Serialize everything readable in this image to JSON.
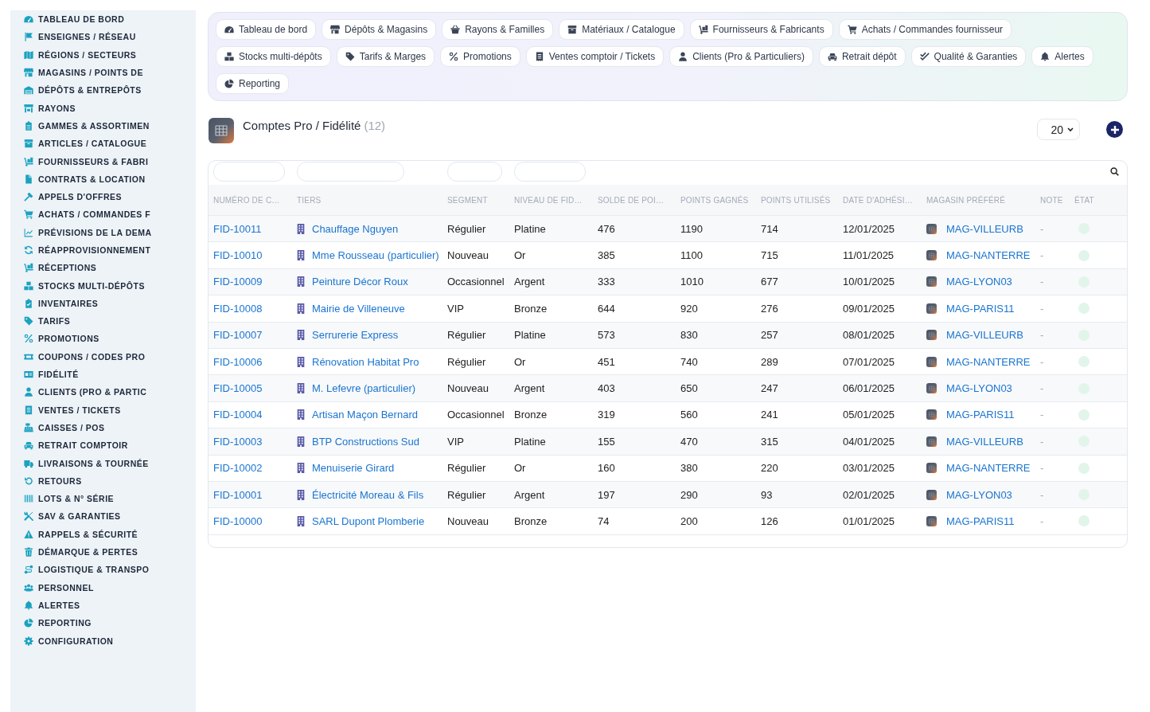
{
  "sidebar": {
    "items": [
      "TABLEAU DE BORD",
      "ENSEIGNES / RÉSEAU",
      "RÉGIONS / SECTEURS",
      "MAGASINS / POINTS DE",
      "DÉPÔTS & ENTREPÔTS",
      "RAYONS",
      "GAMMES & ASSORTIMEN",
      "ARTICLES / CATALOGUE",
      "FOURNISSEURS & FABRI",
      "CONTRATS & LOCATION",
      "APPELS D'OFFRES",
      "ACHATS / COMMANDES F",
      "PRÉVISIONS DE LA DEMA",
      "RÉAPPROVISIONNEMENT",
      "RÉCEPTIONS",
      "STOCKS MULTI-DÉPÔTS",
      "INVENTAIRES",
      "TARIFS",
      "PROMOTIONS",
      "COUPONS / CODES PRO",
      "FIDÉLITÉ",
      "CLIENTS (PRO & PARTIC",
      "VENTES / TICKETS",
      "CAISSES / POS",
      "RETRAIT COMPTOIR",
      "LIVRAISONS & TOURNÉE",
      "RETOURS",
      "LOTS & N° SÉRIE",
      "SAV & GARANTIES",
      "RAPPELS & SÉCURITÉ",
      "DÉMARQUE & PERTES",
      "LOGISTIQUE & TRANSPO",
      "PERSONNEL",
      "ALERTES",
      "REPORTING",
      "CONFIGURATION"
    ]
  },
  "nav": {
    "items": [
      "Tableau de bord",
      "Dépôts & Magasins",
      "Rayons & Familles",
      "Matériaux / Catalogue",
      "Fournisseurs & Fabricants",
      "Achats / Commandes fournisseur",
      "Stocks multi-dépôts",
      "Tarifs & Marges",
      "Promotions",
      "Ventes comptoir / Tickets",
      "Clients (Pro & Particuliers)",
      "Retrait dépôt",
      "Qualité & Garanties",
      "Alertes",
      "Reporting"
    ]
  },
  "header": {
    "title": "Comptes Pro / Fidélité",
    "count": "(12)",
    "page_size": "20"
  },
  "table": {
    "columns": [
      {
        "label": "NUMÉRO DE C…",
        "kind": "link",
        "filter": true
      },
      {
        "label": "TIERS",
        "kind": "entity",
        "filter": true
      },
      {
        "label": "SEGMENT",
        "kind": "text",
        "filter": true
      },
      {
        "label": "NIVEAU DE FID…",
        "kind": "text",
        "filter": true
      },
      {
        "label": "SOLDE DE POI…",
        "kind": "text",
        "filter": false
      },
      {
        "label": "POINTS GAGNÉS",
        "kind": "text",
        "filter": false
      },
      {
        "label": "POINTS UTILISÉS",
        "kind": "text",
        "filter": false
      },
      {
        "label": "DATE D'ADHÉSI…",
        "kind": "text",
        "filter": false
      },
      {
        "label": "MAGASIN PRÉFÉRÉ",
        "kind": "store",
        "filter": false
      },
      {
        "label": "NOTE",
        "kind": "muted",
        "filter": false
      },
      {
        "label": "ÉTAT",
        "kind": "status",
        "filter": false
      }
    ],
    "rows": [
      {
        "cells": [
          "FID-10011",
          "Chauffage Nguyen",
          "Régulier",
          "Platine",
          "476",
          "1190",
          "714",
          "12/01/2025",
          "MAG-VILLEURB",
          "-"
        ]
      },
      {
        "cells": [
          "FID-10010",
          "Mme Rousseau (particulier)",
          "Nouveau",
          "Or",
          "385",
          "1100",
          "715",
          "11/01/2025",
          "MAG-NANTERRE",
          "-"
        ]
      },
      {
        "cells": [
          "FID-10009",
          "Peinture Décor Roux",
          "Occasionnel",
          "Argent",
          "333",
          "1010",
          "677",
          "10/01/2025",
          "MAG-LYON03",
          "-"
        ]
      },
      {
        "cells": [
          "FID-10008",
          "Mairie de Villeneuve",
          "VIP",
          "Bronze",
          "644",
          "920",
          "276",
          "09/01/2025",
          "MAG-PARIS11",
          "-"
        ]
      },
      {
        "cells": [
          "FID-10007",
          "Serrurerie Express",
          "Régulier",
          "Platine",
          "573",
          "830",
          "257",
          "08/01/2025",
          "MAG-VILLEURB",
          "-"
        ]
      },
      {
        "cells": [
          "FID-10006",
          "Rénovation Habitat Pro",
          "Régulier",
          "Or",
          "451",
          "740",
          "289",
          "07/01/2025",
          "MAG-NANTERRE",
          "-"
        ]
      },
      {
        "cells": [
          "FID-10005",
          "M. Lefevre (particulier)",
          "Nouveau",
          "Argent",
          "403",
          "650",
          "247",
          "06/01/2025",
          "MAG-LYON03",
          "-"
        ]
      },
      {
        "cells": [
          "FID-10004",
          "Artisan Maçon Bernard",
          "Occasionnel",
          "Bronze",
          "319",
          "560",
          "241",
          "05/01/2025",
          "MAG-PARIS11",
          "-"
        ]
      },
      {
        "cells": [
          "FID-10003",
          "BTP Constructions Sud",
          "VIP",
          "Platine",
          "155",
          "470",
          "315",
          "04/01/2025",
          "MAG-VILLEURB",
          "-"
        ]
      },
      {
        "cells": [
          "FID-10002",
          "Menuiserie Girard",
          "Régulier",
          "Or",
          "160",
          "380",
          "220",
          "03/01/2025",
          "MAG-NANTERRE",
          "-"
        ]
      },
      {
        "cells": [
          "FID-10001",
          "Électricité Moreau & Fils",
          "Régulier",
          "Argent",
          "197",
          "290",
          "93",
          "02/01/2025",
          "MAG-LYON03",
          "-"
        ]
      },
      {
        "cells": [
          "FID-10000",
          "SARL Dupont Plomberie",
          "Nouveau",
          "Bronze",
          "74",
          "200",
          "126",
          "01/01/2025",
          "MAG-PARIS11",
          "-"
        ]
      }
    ]
  }
}
